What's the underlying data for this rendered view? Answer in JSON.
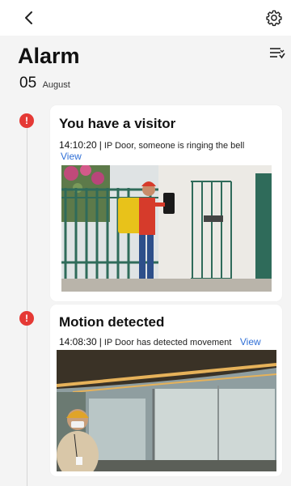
{
  "header": {
    "title": "Alarm",
    "date_day": "05",
    "date_month": "August"
  },
  "events": [
    {
      "title": "You have a visitor",
      "time": "14:10:20",
      "separator": "|",
      "description": "IP Door, someone is ringing the bell",
      "link_label": "View"
    },
    {
      "title": "Motion detected",
      "time": "14:08:30",
      "separator": "|",
      "description": "IP Door has detected movement",
      "link_label": "View"
    }
  ],
  "icons": {
    "back": "chevron-left-icon",
    "settings": "gear-icon",
    "filter": "filter-list-icon",
    "alert": "exclamation-icon"
  },
  "alert_glyph": "!",
  "colors": {
    "alert": "#e53935",
    "link": "#2f6fd6",
    "background": "#f4f4f4",
    "card": "#ffffff"
  }
}
